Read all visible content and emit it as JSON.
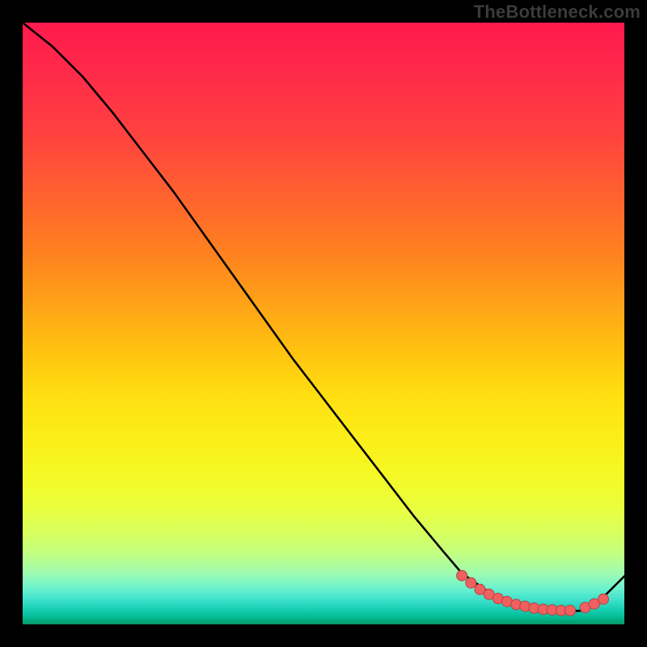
{
  "watermark": "TheBottleneck.com",
  "colors": {
    "frame": "#000000",
    "curve": "#000000",
    "dot_fill": "#ef6060",
    "dot_stroke": "#b94242"
  },
  "chart_data": {
    "type": "line",
    "title": "",
    "xlabel": "",
    "ylabel": "",
    "xlim": [
      0,
      100
    ],
    "ylim": [
      0,
      100
    ],
    "x": [
      0,
      5,
      10,
      15,
      20,
      25,
      30,
      35,
      40,
      45,
      50,
      55,
      60,
      65,
      70,
      73,
      78,
      82,
      86,
      90,
      93,
      96,
      100
    ],
    "y": [
      100,
      96,
      91,
      85,
      78.5,
      72,
      65,
      58,
      51,
      44,
      37.5,
      31,
      24.5,
      18,
      12,
      8.5,
      5,
      3.2,
      2.3,
      2.1,
      2.3,
      4,
      8
    ],
    "highlight_x": [
      73,
      74.5,
      76,
      77.5,
      79,
      80.5,
      82,
      83.5,
      85,
      86.5,
      88,
      89.5,
      91,
      93.5,
      95,
      96.5
    ],
    "highlight_y": [
      8.1,
      6.9,
      5.8,
      5.0,
      4.3,
      3.8,
      3.3,
      3.0,
      2.7,
      2.5,
      2.4,
      2.3,
      2.3,
      2.8,
      3.4,
      4.2
    ]
  }
}
